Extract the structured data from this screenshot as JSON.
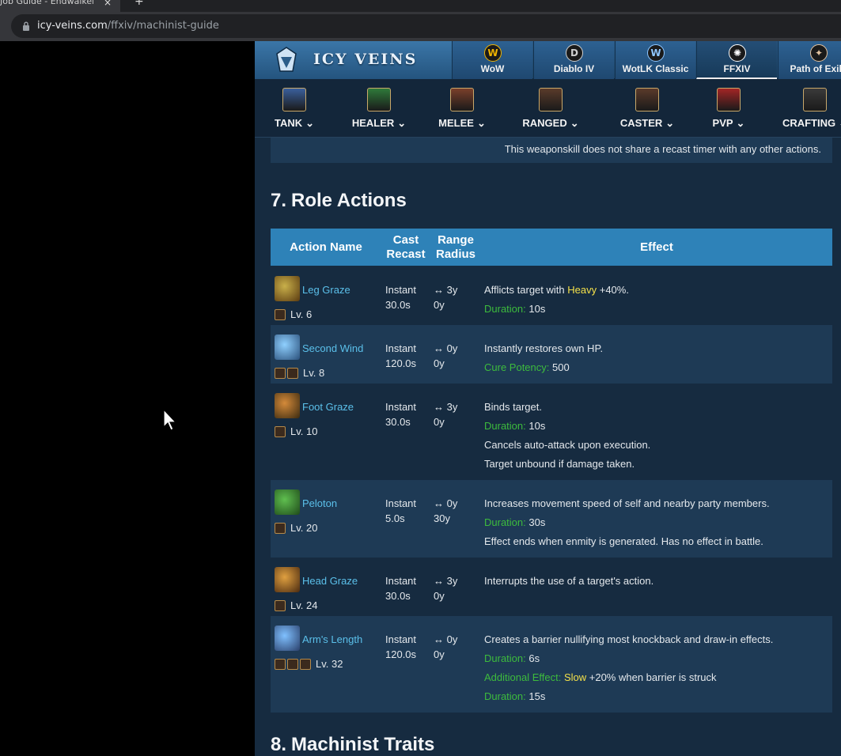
{
  "browser": {
    "tab_title": "Job Guide - Endwalker",
    "tab_close": "×",
    "new_tab": "+",
    "url_host": "icy-veins.com",
    "url_path": "/ffxiv/machinist-guide"
  },
  "site": {
    "logo_text": "ICY VEINS",
    "games": [
      {
        "label": "WoW",
        "icon": "wow-icon",
        "glyph": "W",
        "color": "#f0b400"
      },
      {
        "label": "Diablo IV",
        "icon": "diablo-icon",
        "glyph": "D",
        "color": "#d0d0d0"
      },
      {
        "label": "WotLK Classic",
        "icon": "wotlk-icon",
        "glyph": "W",
        "color": "#8fc7ff"
      },
      {
        "label": "FFXIV",
        "icon": "ffxiv-icon",
        "glyph": "✺",
        "color": "#ffffff"
      },
      {
        "label": "Path of Exile",
        "icon": "poe-icon",
        "glyph": "✦",
        "color": "#e3c3a0"
      }
    ],
    "roles": [
      {
        "label": "TANK",
        "icon": "tank-shield-icon",
        "chevron": "⌄"
      },
      {
        "label": "HEALER",
        "icon": "healer-cross-icon",
        "chevron": "⌄"
      },
      {
        "label": "MELEE",
        "icon": "melee-fist-icon",
        "chevron": "⌄"
      },
      {
        "label": "RANGED",
        "icon": "ranged-bow-icon",
        "chevron": "⌄"
      },
      {
        "label": "CASTER",
        "icon": "caster-staff-icon",
        "chevron": "⌄"
      },
      {
        "label": "PVP",
        "icon": "pvp-swords-icon",
        "chevron": "⌄"
      },
      {
        "label": "CRAFTING",
        "icon": "crafting-anvil-icon",
        "chevron": "⌄"
      }
    ]
  },
  "content": {
    "prev_text": "This weaponskill does not share a recast timer with any other actions.",
    "section7": {
      "num": "7.",
      "title": "Role Actions"
    },
    "headers": {
      "action_name": "Action Name",
      "cast": "Cast",
      "recast": "Recast",
      "range": "Range",
      "radius": "Radius",
      "effect": "Effect"
    },
    "actions": [
      {
        "name": "Leg Graze",
        "level": "Lv. 6",
        "tags": 1,
        "cast": "Instant",
        "recast": "30.0s",
        "range": "↔ 3y",
        "radius": "0y",
        "effects": [
          [
            {
              "t": "Afflicts target with "
            },
            {
              "t": "Heavy",
              "c": "yellow"
            },
            {
              "t": " +40%."
            }
          ],
          [
            {
              "t": "Duration:",
              "c": "green"
            },
            {
              "t": " 10s"
            }
          ]
        ]
      },
      {
        "name": "Second Wind",
        "level": "Lv. 8",
        "tags": 2,
        "cast": "Instant",
        "recast": "120.0s",
        "range": "↔ 0y",
        "radius": "0y",
        "effects": [
          [
            {
              "t": "Instantly restores own HP."
            }
          ],
          [
            {
              "t": "Cure Potency:",
              "c": "green"
            },
            {
              "t": " 500"
            }
          ]
        ]
      },
      {
        "name": "Foot Graze",
        "level": "Lv. 10",
        "tags": 1,
        "cast": "Instant",
        "recast": "30.0s",
        "range": "↔ 3y",
        "radius": "0y",
        "effects": [
          [
            {
              "t": "Binds target."
            }
          ],
          [
            {
              "t": "Duration:",
              "c": "green"
            },
            {
              "t": " 10s"
            }
          ],
          [
            {
              "t": "Cancels auto-attack upon execution."
            }
          ],
          [
            {
              "t": "Target unbound if damage taken."
            }
          ]
        ]
      },
      {
        "name": "Peloton",
        "level": "Lv. 20",
        "tags": 1,
        "cast": "Instant",
        "recast": "5.0s",
        "range": "↔ 0y",
        "radius": "30y",
        "effects": [
          [
            {
              "t": "Increases movement speed of self and nearby party members."
            }
          ],
          [
            {
              "t": "Duration:",
              "c": "green"
            },
            {
              "t": " 30s"
            }
          ],
          [
            {
              "t": "Effect ends when enmity is generated. Has no effect in battle."
            }
          ]
        ]
      },
      {
        "name": "Head Graze",
        "level": "Lv. 24",
        "tags": 1,
        "cast": "Instant",
        "recast": "30.0s",
        "range": "↔ 3y",
        "radius": "0y",
        "effects": [
          [
            {
              "t": "Interrupts the use of a target's action."
            }
          ]
        ]
      },
      {
        "name": "Arm's Length",
        "level": "Lv. 32",
        "tags": 3,
        "cast": "Instant",
        "recast": "120.0s",
        "range": "↔ 0y",
        "radius": "0y",
        "effects": [
          [
            {
              "t": "Creates a barrier nullifying most knockback and draw-in effects."
            }
          ],
          [
            {
              "t": "Duration:",
              "c": "green"
            },
            {
              "t": " 6s"
            }
          ],
          [
            {
              "t": "Additional Effect:",
              "c": "green"
            },
            {
              "t": " "
            },
            {
              "t": "Slow",
              "c": "yellow"
            },
            {
              "t": " +20% when barrier is struck"
            }
          ],
          [
            {
              "t": "Duration:",
              "c": "green"
            },
            {
              "t": " 15s"
            }
          ]
        ]
      }
    ],
    "section8": {
      "num": "8.",
      "title": "Machinist Traits"
    }
  }
}
